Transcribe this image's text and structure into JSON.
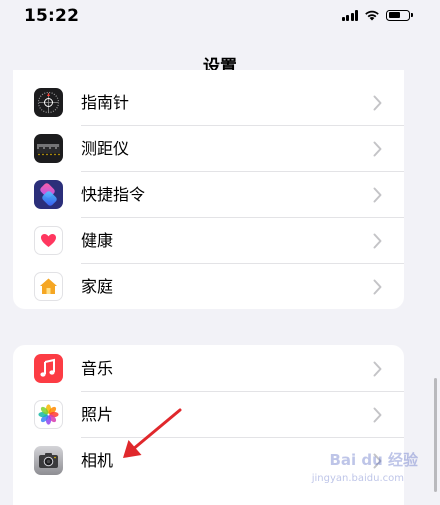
{
  "status_bar": {
    "time": "15:22",
    "signal_icon": "cellular-signal-icon",
    "wifi_icon": "wifi-icon",
    "battery_icon": "battery-icon"
  },
  "nav": {
    "title": "设置"
  },
  "group_1": {
    "items": [
      {
        "label": "指南针",
        "icon": "compass-icon",
        "color": "#1c1c1e"
      },
      {
        "label": "测距仪",
        "icon": "measure-icon",
        "color": "#1c1c1e"
      },
      {
        "label": "快捷指令",
        "icon": "shortcuts-icon",
        "color": "#2b2f7a"
      },
      {
        "label": "健康",
        "icon": "health-icon",
        "color": "#ff375f"
      },
      {
        "label": "家庭",
        "icon": "home-icon",
        "color": "#f5a623"
      }
    ]
  },
  "group_2": {
    "items": [
      {
        "label": "音乐",
        "icon": "music-icon",
        "color": "#fc3c44"
      },
      {
        "label": "照片",
        "icon": "photos-icon",
        "color": "#ffffff"
      },
      {
        "label": "相机",
        "icon": "camera-icon",
        "color": "#8e8e93"
      }
    ]
  },
  "annotation": {
    "arrow_color": "#e0282c",
    "target": "相机"
  },
  "watermark": {
    "text": "Bai du 经验",
    "subtext": "jingyan.baidu.com"
  }
}
